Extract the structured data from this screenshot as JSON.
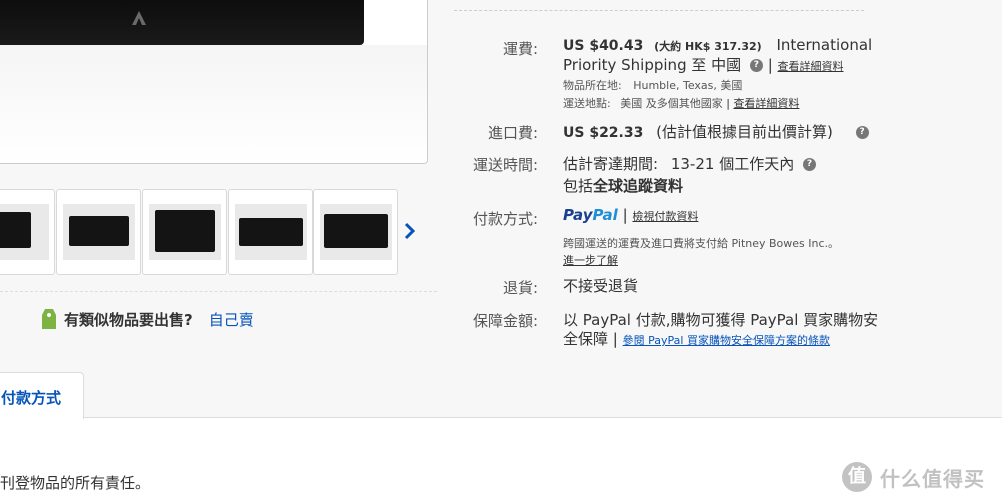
{
  "gallery": {
    "thumbnail_count": 5,
    "sell_similar_question": "有類似物品要出售?",
    "sell_yourself_link": "自己賣"
  },
  "tabs": {
    "payment_tab_label": "付款方式"
  },
  "shipping": {
    "label": "運費:",
    "price": "US $40.43",
    "approx": "(大約 HK$ 317.32)",
    "service_line1": "International",
    "service_line2": "Priority Shipping 至 中國",
    "details_link": "查看詳細資料",
    "item_location_label": "物品所在地:",
    "item_location": "Humble, Texas, 美國",
    "ships_to_label": "運送地點:",
    "ships_to": "美國 及多個其他國家",
    "ships_to_details_link": "查看詳細資料"
  },
  "import_charges": {
    "label": "進口費:",
    "price": "US $22.33",
    "note": "(估計值根據目前出價計算)"
  },
  "delivery": {
    "label": "運送時間:",
    "estimate_label": "估計寄達期間:",
    "estimate": "13-21 個工作天內",
    "includes_prefix": "包括",
    "tracking": "全球追蹤資料"
  },
  "payment": {
    "label": "付款方式:",
    "paypal_part1": "Pay",
    "paypal_part2": "Pal",
    "details_link": "檢視付款資料",
    "pitney_note": "跨國運送的運費及進口費將支付給 Pitney Bowes Inc.。",
    "learn_more_link": "進一步了解"
  },
  "returns": {
    "label": "退貨:",
    "value": "不接受退貨"
  },
  "guarantee": {
    "label": "保障金額:",
    "line1": "以 PayPal 付款,購物可獲得 PayPal 買家購物安",
    "line2": "全保障",
    "terms_link": "參閱 PayPal 買家購物安全保障方案的條款"
  },
  "footer": {
    "text": "刊登物品的所有責任。",
    "watermark_glyph": "值",
    "watermark_text": "什么值得买"
  },
  "colors": {
    "link_blue": "#0654ba",
    "paypal_dark": "#1b3f8f",
    "paypal_light": "#1f8ed6",
    "tag_green": "#7cb342"
  }
}
